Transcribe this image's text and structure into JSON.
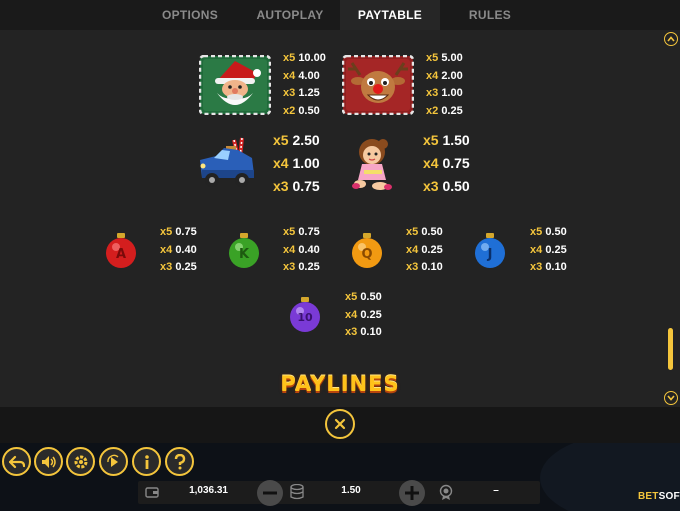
{
  "tabs": [
    {
      "label": "OPTIONS",
      "active": false
    },
    {
      "label": "AUTOPLAY",
      "active": false
    },
    {
      "label": "PAYTABLE",
      "active": true
    },
    {
      "label": "RULES",
      "active": false
    }
  ],
  "paytable": {
    "santa": [
      {
        "m": "x5",
        "v": "10.00"
      },
      {
        "m": "x4",
        "v": "4.00"
      },
      {
        "m": "x3",
        "v": "1.25"
      },
      {
        "m": "x2",
        "v": "0.50"
      }
    ],
    "reindeer": [
      {
        "m": "x5",
        "v": "5.00"
      },
      {
        "m": "x4",
        "v": "2.00"
      },
      {
        "m": "x3",
        "v": "1.00"
      },
      {
        "m": "x2",
        "v": "0.25"
      }
    ],
    "truck": [
      {
        "m": "x5",
        "v": "2.50"
      },
      {
        "m": "x4",
        "v": "1.00"
      },
      {
        "m": "x3",
        "v": "0.75"
      }
    ],
    "girl": [
      {
        "m": "x5",
        "v": "1.50"
      },
      {
        "m": "x4",
        "v": "0.75"
      },
      {
        "m": "x3",
        "v": "0.50"
      }
    ],
    "ornament_red": [
      {
        "m": "x5",
        "v": "0.75"
      },
      {
        "m": "x4",
        "v": "0.40"
      },
      {
        "m": "x3",
        "v": "0.25"
      }
    ],
    "ornament_green": [
      {
        "m": "x5",
        "v": "0.75"
      },
      {
        "m": "x4",
        "v": "0.40"
      },
      {
        "m": "x3",
        "v": "0.25"
      }
    ],
    "ornament_orange": [
      {
        "m": "x5",
        "v": "0.50"
      },
      {
        "m": "x4",
        "v": "0.25"
      },
      {
        "m": "x3",
        "v": "0.10"
      }
    ],
    "ornament_blue": [
      {
        "m": "x5",
        "v": "0.50"
      },
      {
        "m": "x4",
        "v": "0.25"
      },
      {
        "m": "x3",
        "v": "0.10"
      }
    ],
    "ornament_purple": [
      {
        "m": "x5",
        "v": "0.50"
      },
      {
        "m": "x4",
        "v": "0.25"
      },
      {
        "m": "x3",
        "v": "0.10"
      }
    ]
  },
  "ornament_letters": {
    "red": "A",
    "green": "K",
    "orange": "Q",
    "blue": "J",
    "purple": "10"
  },
  "paylines_title": "PAYLINES",
  "footer": {
    "balance": "1,036.31",
    "bet": "1.50",
    "win": "–",
    "logo_bet": "BET",
    "logo_soft": "SOFT"
  },
  "colors": {
    "accent": "#f4c53c",
    "panel": "#232323",
    "tab_bar": "#1a1a1a",
    "bottom_bar": "#0d1117"
  },
  "icons": [
    "scroll-up-icon",
    "scroll-down-icon",
    "close-icon",
    "back-icon",
    "sound-icon",
    "settings-icon",
    "play-icon",
    "info-icon",
    "help-icon",
    "wallet-icon",
    "minus-icon",
    "coins-icon",
    "plus-icon",
    "win-medal-icon"
  ]
}
